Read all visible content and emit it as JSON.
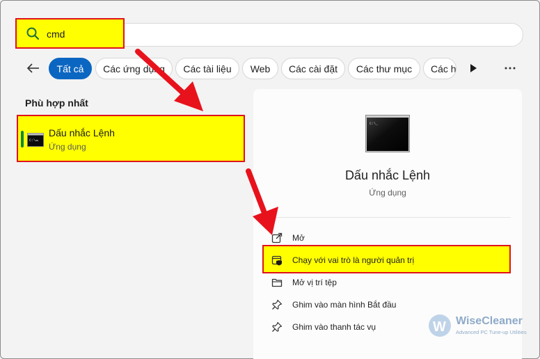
{
  "search": {
    "query": "cmd"
  },
  "filters": {
    "tabs": [
      {
        "label": "Tất cả",
        "active": true
      },
      {
        "label": "Các ứng dụng"
      },
      {
        "label": "Các tài liệu"
      },
      {
        "label": "Web"
      },
      {
        "label": "Các cài đặt"
      },
      {
        "label": "Các thư mục"
      },
      {
        "label": "Các h"
      }
    ]
  },
  "best_match": {
    "section_title": "Phù hợp nhất",
    "result": {
      "name": "Dấu nhắc Lệnh",
      "type": "Ứng dụng"
    }
  },
  "detail": {
    "name": "Dấu nhắc Lệnh",
    "type": "Ứng dụng",
    "actions": [
      {
        "label": "Mở",
        "icon": "open-external-icon"
      },
      {
        "label": "Chạy với vai trò là người quản trị",
        "icon": "shield-admin-icon"
      },
      {
        "label": "Mở vị trí tệp",
        "icon": "folder-icon"
      },
      {
        "label": "Ghim vào màn hình Bắt đầu",
        "icon": "pin-icon"
      },
      {
        "label": "Ghim vào thanh tác vụ",
        "icon": "pin-icon"
      }
    ]
  },
  "watermark": {
    "brand": "WiseCleaner",
    "tagline": "Advanced PC Tune-up Utilities"
  },
  "colors": {
    "accent": "#0b66c2",
    "highlight": "#ffff00",
    "annotation": "#e0121c",
    "indicator": "#0b8a3e"
  }
}
